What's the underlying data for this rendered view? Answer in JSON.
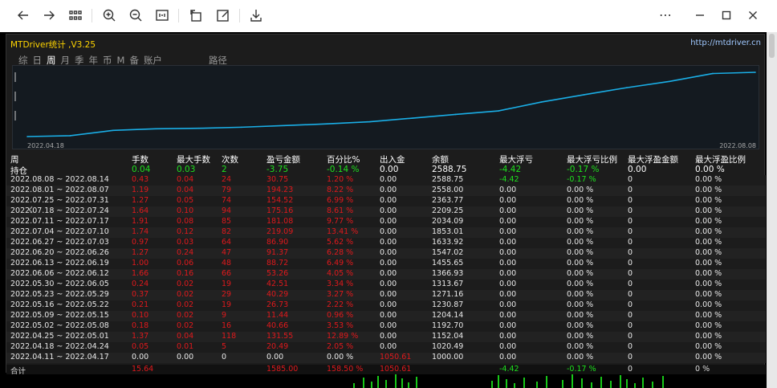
{
  "toolbar": {
    "icons": [
      "back-arrow-icon",
      "forward-arrow-icon",
      "grid-icon",
      "zoom-in-icon",
      "zoom-out-icon",
      "fit-icon",
      "rotate-icon",
      "edit-icon",
      "save-icon",
      "more-icon",
      "minimize-icon",
      "maximize-icon",
      "close-icon"
    ]
  },
  "panel": {
    "title": "MTDriver统计 ,V3.25",
    "url": "http://mtdriver.cn"
  },
  "tabs": [
    {
      "label": "综",
      "active": false
    },
    {
      "label": "日",
      "active": false
    },
    {
      "label": "周",
      "active": true
    },
    {
      "label": "月",
      "active": false
    },
    {
      "label": "季",
      "active": false
    },
    {
      "label": "年",
      "active": false
    },
    {
      "label": "币",
      "active": false
    },
    {
      "label": "M",
      "active": false
    },
    {
      "label": "备",
      "active": false
    },
    {
      "label": "账户",
      "active": false
    }
  ],
  "tab_path": "路径",
  "chart_data": {
    "type": "line",
    "x": [
      "2022.04.11",
      "2022.04.18",
      "2022.04.25",
      "2022.05.02",
      "2022.05.09",
      "2022.05.16",
      "2022.05.23",
      "2022.05.30",
      "2022.06.06",
      "2022.06.13",
      "2022.06.20",
      "2022.06.27",
      "2022.07.04",
      "2022.07.11",
      "2022.07.18",
      "2022.07.25",
      "2022.08.01",
      "2022.08.08"
    ],
    "values": [
      1000.0,
      1020.49,
      1152.04,
      1192.7,
      1204.14,
      1230.87,
      1271.16,
      1313.67,
      1366.93,
      1455.65,
      1547.02,
      1633.92,
      1853.01,
      2034.09,
      2209.25,
      2363.77,
      2558.0,
      2588.75
    ],
    "x_start_label": "2022.04.18",
    "x_end_label": "2022.08.08",
    "color": "#1aaee6"
  },
  "headers": {
    "period": "周",
    "lots": "手数",
    "max_lots": "最大手数",
    "trades": "次数",
    "profit": "盈亏金额",
    "percent": "百分比%",
    "deposit": "出入金",
    "balance": "余额",
    "max_float_loss": "最大浮亏",
    "max_float_loss_pct": "最大浮亏比例",
    "max_float_profit": "最大浮盈金额",
    "max_float_profit_pct": "最大浮盈比例"
  },
  "holding": {
    "label": "持仓",
    "lots": "0.04",
    "max_lots": "0.03",
    "trades": "2",
    "profit": "-3.75",
    "percent": "-0.14 %",
    "deposit": "0.00",
    "balance": "2588.75",
    "max_float_loss": "-4.42",
    "max_float_loss_pct": "-0.17 %",
    "max_float_profit": "0.00",
    "max_float_profit_pct": "0.00 %"
  },
  "rows": [
    {
      "period": "2022.08.08 ~ 2022.08.14",
      "lots": "0.43",
      "max_lots": "0.04",
      "trades": "24",
      "profit": "30.75",
      "percent": "1.20 %",
      "deposit": "0.00",
      "balance": "2588.75",
      "max_float_loss": "-4.42",
      "max_float_loss_pct": "-0.17 %",
      "max_float_profit": "0",
      "max_float_profit_pct": "0.00 %"
    },
    {
      "period": "2022.08.01 ~ 2022.08.07",
      "lots": "1.19",
      "max_lots": "0.04",
      "trades": "79",
      "profit": "194.23",
      "percent": "8.22 %",
      "deposit": "0.00",
      "balance": "2558.00",
      "max_float_loss": "0.00",
      "max_float_loss_pct": "0.00 %",
      "max_float_profit": "0",
      "max_float_profit_pct": "0.00 %"
    },
    {
      "period": "2022.07.25 ~ 2022.07.31",
      "lots": "1.27",
      "max_lots": "0.05",
      "trades": "74",
      "profit": "154.52",
      "percent": "6.99 %",
      "deposit": "0.00",
      "balance": "2363.77",
      "max_float_loss": "0.00",
      "max_float_loss_pct": "0.00 %",
      "max_float_profit": "0",
      "max_float_profit_pct": "0.00 %"
    },
    {
      "period": "2022.07.18 ~ 2022.07.24",
      "lots": "1.64",
      "max_lots": "0.10",
      "trades": "94",
      "profit": "175.16",
      "percent": "8.61 %",
      "deposit": "0.00",
      "balance": "2209.25",
      "max_float_loss": "0.00",
      "max_float_loss_pct": "0.00 %",
      "max_float_profit": "0",
      "max_float_profit_pct": "0.00 %"
    },
    {
      "period": "2022.07.11 ~ 2022.07.17",
      "lots": "1.91",
      "max_lots": "0.08",
      "trades": "85",
      "profit": "181.08",
      "percent": "9.77 %",
      "deposit": "0.00",
      "balance": "2034.09",
      "max_float_loss": "0.00",
      "max_float_loss_pct": "0.00 %",
      "max_float_profit": "0",
      "max_float_profit_pct": "0.00 %"
    },
    {
      "period": "2022.07.04 ~ 2022.07.10",
      "lots": "1.74",
      "max_lots": "0.12",
      "trades": "82",
      "profit": "219.09",
      "percent": "13.41 %",
      "deposit": "0.00",
      "balance": "1853.01",
      "max_float_loss": "0.00",
      "max_float_loss_pct": "0.00 %",
      "max_float_profit": "0",
      "max_float_profit_pct": "0.00 %"
    },
    {
      "period": "2022.06.27 ~ 2022.07.03",
      "lots": "0.97",
      "max_lots": "0.03",
      "trades": "64",
      "profit": "86.90",
      "percent": "5.62 %",
      "deposit": "0.00",
      "balance": "1633.92",
      "max_float_loss": "0.00",
      "max_float_loss_pct": "0.00 %",
      "max_float_profit": "0",
      "max_float_profit_pct": "0.00 %"
    },
    {
      "period": "2022.06.20 ~ 2022.06.26",
      "lots": "1.27",
      "max_lots": "0.24",
      "trades": "47",
      "profit": "91.37",
      "percent": "6.28 %",
      "deposit": "0.00",
      "balance": "1547.02",
      "max_float_loss": "0.00",
      "max_float_loss_pct": "0.00 %",
      "max_float_profit": "0",
      "max_float_profit_pct": "0.00 %"
    },
    {
      "period": "2022.06.13 ~ 2022.06.19",
      "lots": "1.00",
      "max_lots": "0.06",
      "trades": "48",
      "profit": "88.72",
      "percent": "6.49 %",
      "deposit": "0.00",
      "balance": "1455.65",
      "max_float_loss": "0.00",
      "max_float_loss_pct": "0.00 %",
      "max_float_profit": "0",
      "max_float_profit_pct": "0.00 %"
    },
    {
      "period": "2022.06.06 ~ 2022.06.12",
      "lots": "1.66",
      "max_lots": "0.16",
      "trades": "66",
      "profit": "53.26",
      "percent": "4.05 %",
      "deposit": "0.00",
      "balance": "1366.93",
      "max_float_loss": "0.00",
      "max_float_loss_pct": "0.00 %",
      "max_float_profit": "0",
      "max_float_profit_pct": "0.00 %"
    },
    {
      "period": "2022.05.30 ~ 2022.06.05",
      "lots": "0.24",
      "max_lots": "0.02",
      "trades": "19",
      "profit": "42.51",
      "percent": "3.34 %",
      "deposit": "0.00",
      "balance": "1313.67",
      "max_float_loss": "0.00",
      "max_float_loss_pct": "0.00 %",
      "max_float_profit": "0",
      "max_float_profit_pct": "0.00 %"
    },
    {
      "period": "2022.05.23 ~ 2022.05.29",
      "lots": "0.37",
      "max_lots": "0.02",
      "trades": "29",
      "profit": "40.29",
      "percent": "3.27 %",
      "deposit": "0.00",
      "balance": "1271.16",
      "max_float_loss": "0.00",
      "max_float_loss_pct": "0.00 %",
      "max_float_profit": "0",
      "max_float_profit_pct": "0.00 %"
    },
    {
      "period": "2022.05.16 ~ 2022.05.22",
      "lots": "0.21",
      "max_lots": "0.02",
      "trades": "19",
      "profit": "26.73",
      "percent": "2.22 %",
      "deposit": "0.00",
      "balance": "1230.87",
      "max_float_loss": "0.00",
      "max_float_loss_pct": "0.00 %",
      "max_float_profit": "0",
      "max_float_profit_pct": "0.00 %"
    },
    {
      "period": "2022.05.09 ~ 2022.05.15",
      "lots": "0.10",
      "max_lots": "0.02",
      "trades": "9",
      "profit": "11.44",
      "percent": "0.96 %",
      "deposit": "0.00",
      "balance": "1204.14",
      "max_float_loss": "0.00",
      "max_float_loss_pct": "0.00 %",
      "max_float_profit": "0",
      "max_float_profit_pct": "0.00 %"
    },
    {
      "period": "2022.05.02 ~ 2022.05.08",
      "lots": "0.18",
      "max_lots": "0.02",
      "trades": "16",
      "profit": "40.66",
      "percent": "3.53 %",
      "deposit": "0.00",
      "balance": "1192.70",
      "max_float_loss": "0.00",
      "max_float_loss_pct": "0.00 %",
      "max_float_profit": "0",
      "max_float_profit_pct": "0.00 %"
    },
    {
      "period": "2022.04.25 ~ 2022.05.01",
      "lots": "1.37",
      "max_lots": "0.04",
      "trades": "118",
      "profit": "131.55",
      "percent": "12.89 %",
      "deposit": "0.00",
      "balance": "1152.04",
      "max_float_loss": "0.00",
      "max_float_loss_pct": "0.00 %",
      "max_float_profit": "0",
      "max_float_profit_pct": "0.00 %"
    },
    {
      "period": "2022.04.18 ~ 2022.04.24",
      "lots": "0.05",
      "max_lots": "0.01",
      "trades": "5",
      "profit": "20.49",
      "percent": "2.05 %",
      "deposit": "0.00",
      "balance": "1020.49",
      "max_float_loss": "0.00",
      "max_float_loss_pct": "0.00 %",
      "max_float_profit": "0",
      "max_float_profit_pct": "0.00 %"
    },
    {
      "period": "2022.04.11 ~ 2022.04.17",
      "lots": "0.00",
      "max_lots": "0.00",
      "trades": "0",
      "profit": "0.00",
      "percent": "0.00 %",
      "deposit": "1050.61",
      "balance": "1000.00",
      "max_float_loss": "0.00",
      "max_float_loss_pct": "0.00 %",
      "max_float_profit": "0",
      "max_float_profit_pct": "0.00 %"
    }
  ],
  "total": {
    "label": "合计",
    "lots": "15.64",
    "profit": "1585.00",
    "percent": "158.50 %",
    "deposit": "1050.61",
    "max_float_loss": "-4.42",
    "max_float_loss_pct": "-0.17 %",
    "max_float_profit": "0",
    "max_float_profit_pct": "0 %"
  },
  "colors": {
    "negative": "#e0191c",
    "positive": "#1ee01e",
    "line": "#1aaee6"
  }
}
